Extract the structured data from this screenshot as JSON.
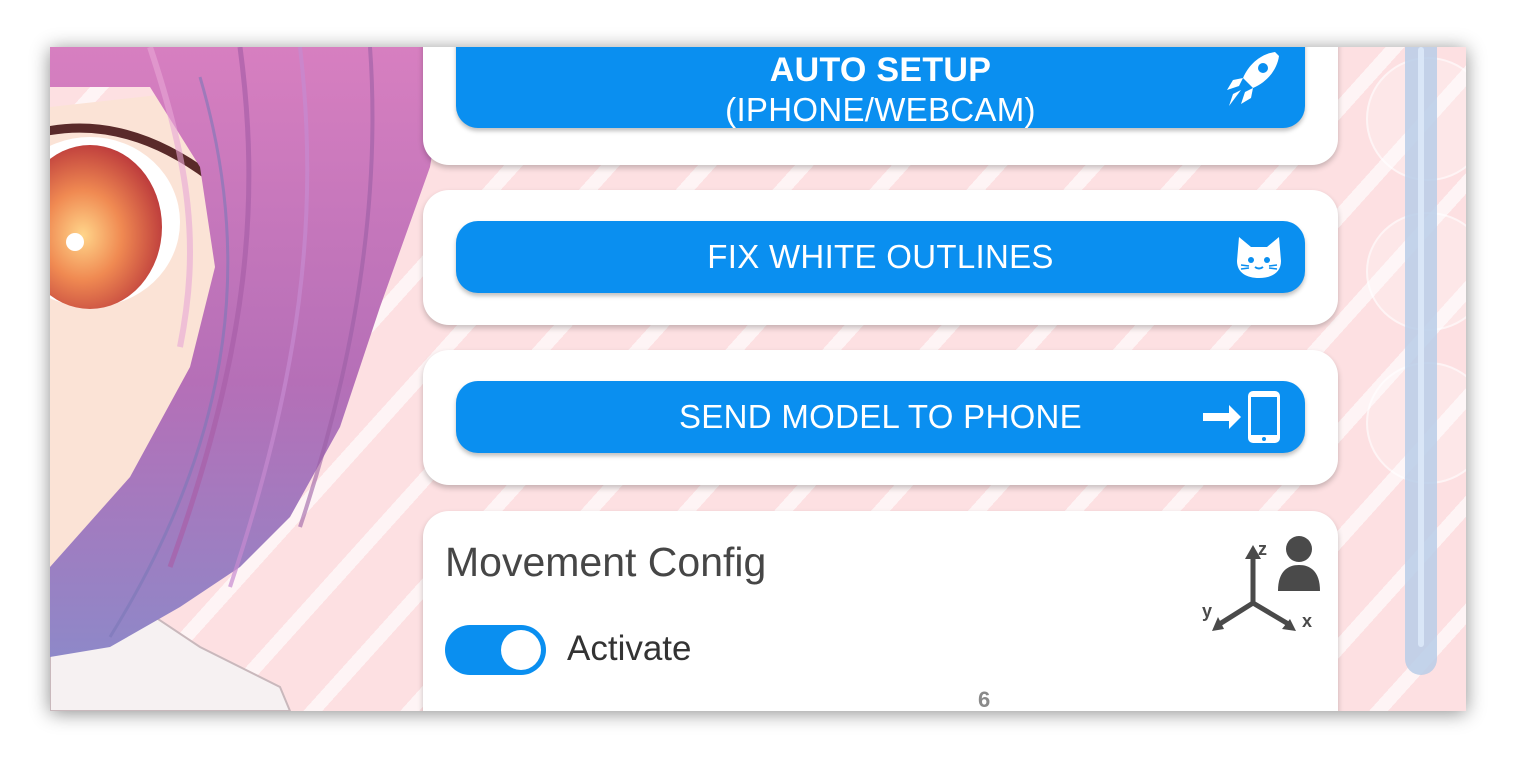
{
  "buttons": {
    "auto_setup": {
      "line1": "AUTO SETUP",
      "line2": "(IPHONE/WEBCAM)",
      "icon": "rocket-icon"
    },
    "fix_outlines": {
      "label": "FIX WHITE OUTLINES",
      "icon": "cat-face-icon"
    },
    "send_model": {
      "label": "SEND MODEL TO PHONE",
      "icon": "arrow-to-phone-icon"
    }
  },
  "movement_config": {
    "title": "Movement Config",
    "toggle_label": "Activate",
    "toggle_on": true,
    "icon": "xyz-axes-person-icon"
  },
  "page_number": "6",
  "colors": {
    "accent": "#0a8ff0",
    "background": "#fde0e2",
    "card": "#ffffff"
  }
}
